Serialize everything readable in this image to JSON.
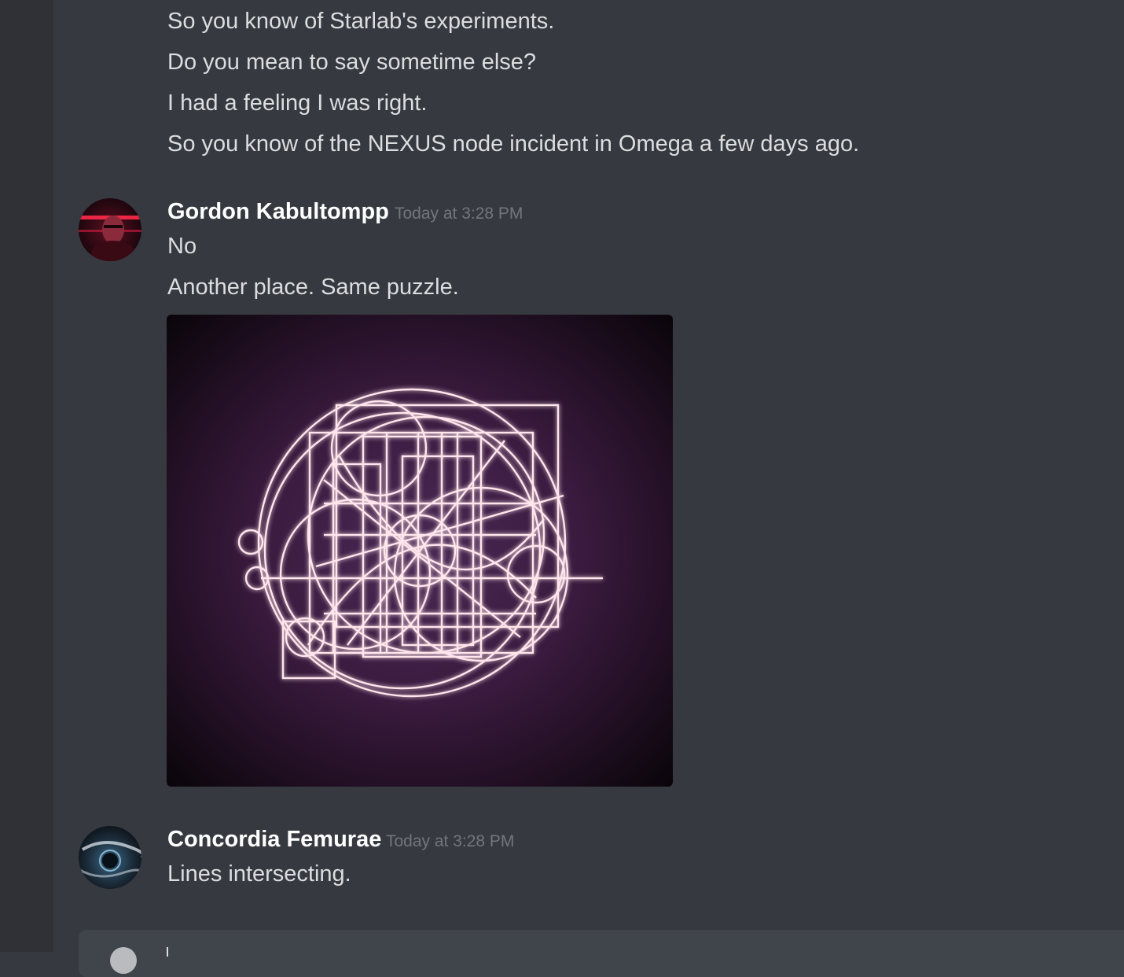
{
  "earlier_messages": [
    "So you know of Starlab's experiments.",
    "Do you mean to say sometime else?",
    "I had a feeling I was right.",
    "So you know of the NEXUS node incident in Omega a few days ago."
  ],
  "messages": [
    {
      "author": "Gordon Kabultompp",
      "timestamp": "Today at 3:28 PM",
      "lines": [
        "No",
        "Another place. Same puzzle."
      ],
      "attachment": "glowing-geometric-image"
    },
    {
      "author": "Concordia Femurae",
      "timestamp": "Today at 3:28 PM",
      "lines": [
        "Lines intersecting."
      ]
    }
  ],
  "colors": {
    "background": "#36393f",
    "sidebar": "#2f3136",
    "text": "#dcddde",
    "username": "#ffffff",
    "timestamp": "#72767d",
    "composer": "#40444b"
  }
}
